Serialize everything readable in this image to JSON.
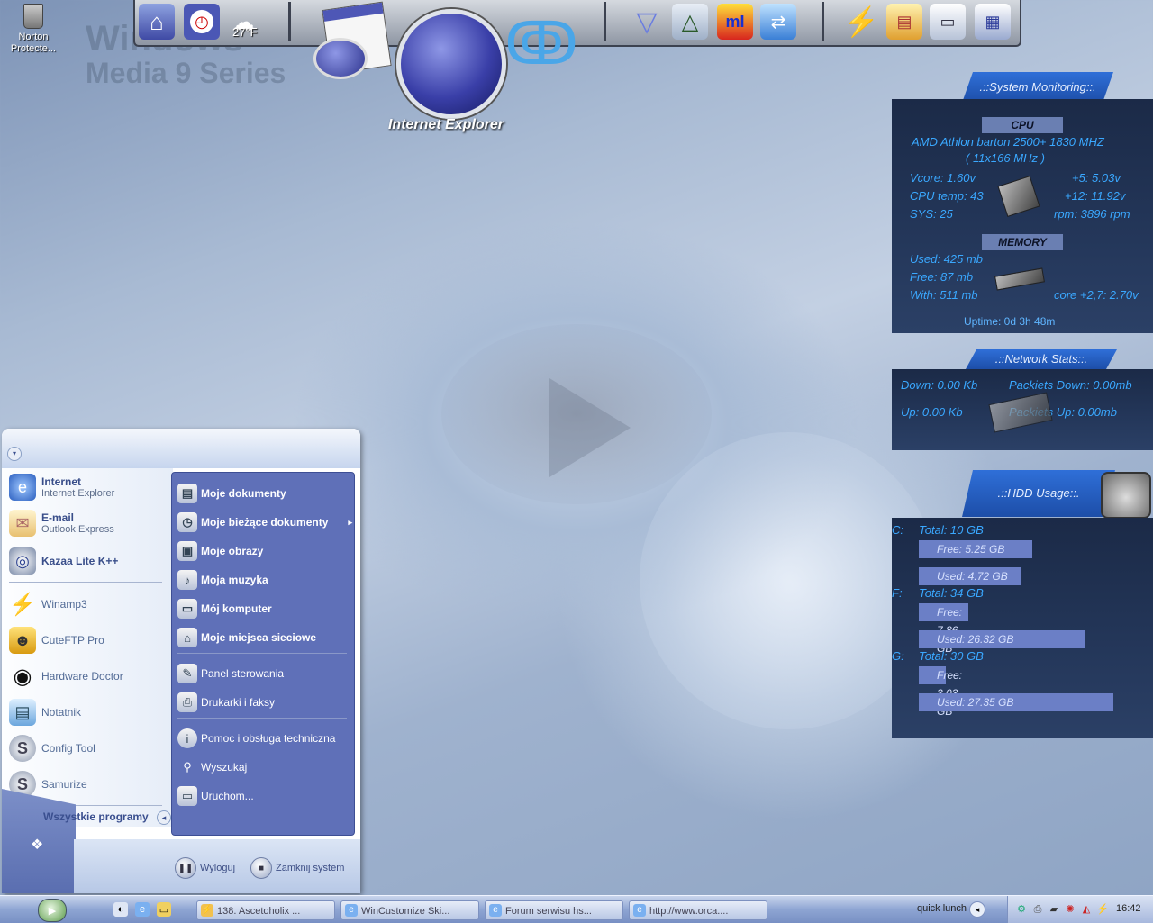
{
  "desktop": {
    "watermark": [
      "Windows",
      "Media 9 Series"
    ],
    "icons": [
      {
        "label": "Norton Protecte..."
      }
    ]
  },
  "dock": {
    "weather_temp": "27°F",
    "ie_label": "Internet Explorer"
  },
  "system_monitor": {
    "title": ".::System Monitoring::.",
    "cpu_header": "CPU",
    "cpu_model": "AMD Athlon barton 2500+ 1830 MHZ",
    "cpu_bus": "( 11x166 MHz )",
    "vcore": "Vcore: 1.60v",
    "plus5": "+5: 5.03v",
    "cpu_temp": "CPU temp: 43",
    "plus12": "+12: 11.92v",
    "sys_temp": "SYS: 25",
    "fan": "rpm: 3896 rpm",
    "memory_header": "MEMORY",
    "mem_used": "Used: 425 mb",
    "mem_free": "Free: 87 mb",
    "mem_total": "With: 511 mb",
    "core_volt": "core +2,7: 2.70v",
    "uptime": "Uptime: 0d 3h 48m"
  },
  "network_stats": {
    "title": ".::Network Stats::.",
    "down": "Down: 0.00 Kb",
    "packets_down": "Packiets Down: 0.00mb",
    "up": "Up: 0.00 Kb",
    "packets_up": "Packiets Up: 0.00mb"
  },
  "hdd_usage": {
    "title": ".::HDD Usage::.",
    "drives": [
      {
        "letter": "C:",
        "total": "Total: 10 GB",
        "free": "Free: 5.25 GB",
        "used": "Used: 4.72 GB",
        "free_frac": 0.525,
        "used_frac": 0.472
      },
      {
        "letter": "F:",
        "total": "Total: 34 GB",
        "free": "Free: 7.86 GB",
        "used": "Used: 26.32 GB",
        "free_frac": 0.23,
        "used_frac": 0.77
      },
      {
        "letter": "G:",
        "total": "Total: 30 GB",
        "free": "Free: 3.03 GB",
        "used": "Used: 27.35 GB",
        "free_frac": 0.1,
        "used_frac": 0.9
      }
    ]
  },
  "start_menu": {
    "pinned": [
      {
        "title": "Internet",
        "subtitle": "Internet Explorer",
        "icon": "ie-icon"
      },
      {
        "title": "E-mail",
        "subtitle": "Outlook Express",
        "icon": "mail-icon"
      }
    ],
    "recent": [
      {
        "label": "Kazaa Lite K++",
        "icon": "kazaa-icon"
      },
      {
        "label": "Winamp3",
        "icon": "winamp-icon"
      },
      {
        "label": "CuteFTP Pro",
        "icon": "cuteftp-icon"
      },
      {
        "label": "Hardware Doctor",
        "icon": "eye-icon"
      },
      {
        "label": "Notatnik",
        "icon": "notepad-icon"
      },
      {
        "label": "Config Tool",
        "icon": "samurize-icon"
      },
      {
        "label": "Samurize",
        "icon": "samurize-icon"
      }
    ],
    "all_programs": "Wszystkie programy",
    "right": [
      {
        "label": "Moje dokumenty",
        "bold": true
      },
      {
        "label": "Moje bieżące dokumenty",
        "bold": true,
        "submenu": true
      },
      {
        "label": "Moje obrazy",
        "bold": true
      },
      {
        "label": "Moja muzyka",
        "bold": true
      },
      {
        "label": "Mój komputer",
        "bold": true
      },
      {
        "label": "Moje miejsca sieciowe",
        "bold": true
      },
      {
        "label": "Panel sterowania",
        "bold": false
      },
      {
        "label": "Drukarki i faksy",
        "bold": false
      },
      {
        "label": "Pomoc i obsługa techniczna",
        "bold": false
      },
      {
        "label": "Wyszukaj",
        "bold": false
      },
      {
        "label": "Uruchom...",
        "bold": false
      }
    ],
    "logoff": "Wyloguj",
    "shutdown": "Zamknij system"
  },
  "taskbar": {
    "tasks": [
      {
        "label": "138. Ascetoholix ..."
      },
      {
        "label": "WinCustomize Ski..."
      },
      {
        "label": "Forum serwisu hs..."
      },
      {
        "label": "http://www.orca...."
      }
    ],
    "quick_launch_label": "quick lunch",
    "clock": "16:42"
  }
}
